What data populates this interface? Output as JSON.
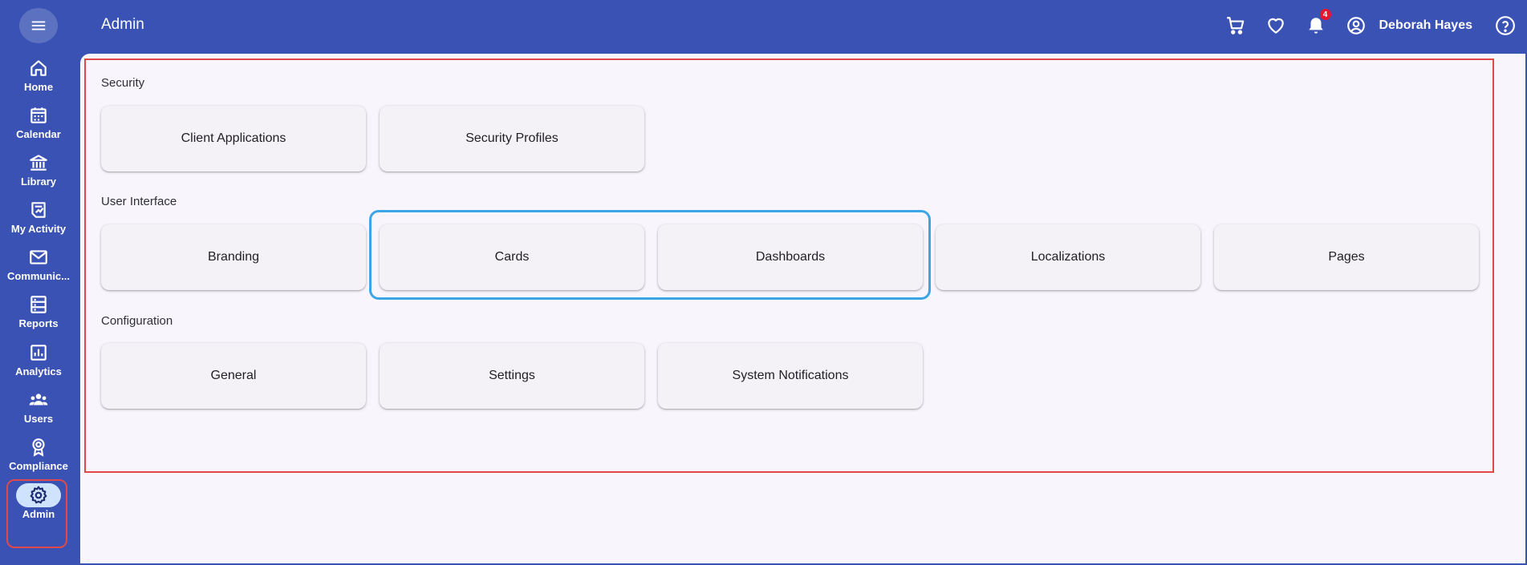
{
  "header": {
    "title": "Admin",
    "user_name": "Deborah Hayes",
    "notification_count": "4"
  },
  "sidebar": {
    "items": [
      {
        "label": "Home",
        "icon": "home-icon"
      },
      {
        "label": "Calendar",
        "icon": "calendar-icon"
      },
      {
        "label": "Library",
        "icon": "library-icon"
      },
      {
        "label": "My Activity",
        "icon": "activity-icon"
      },
      {
        "label": "Communic...",
        "icon": "mail-icon"
      },
      {
        "label": "Reports",
        "icon": "reports-icon"
      },
      {
        "label": "Analytics",
        "icon": "analytics-icon"
      },
      {
        "label": "Users",
        "icon": "users-icon"
      },
      {
        "label": "Compliance",
        "icon": "compliance-icon"
      },
      {
        "label": "Admin",
        "icon": "gear-icon",
        "active": true
      }
    ]
  },
  "sections": {
    "security": {
      "title": "Security",
      "cards": [
        "Client Applications",
        "Security Profiles"
      ]
    },
    "user_interface": {
      "title": "User Interface",
      "cards": [
        "Branding",
        "Cards",
        "Dashboards",
        "Localizations",
        "Pages"
      ]
    },
    "configuration": {
      "title": "Configuration",
      "cards": [
        "General",
        "Settings",
        "System Notifications"
      ]
    }
  },
  "colors": {
    "brand": "#3a52b4",
    "content_bg": "#f8f6fc",
    "card_bg": "#f4f2f7",
    "annotation_red": "#e0484a",
    "annotation_blue": "#3ba5e6",
    "badge_red": "#e5172f"
  }
}
